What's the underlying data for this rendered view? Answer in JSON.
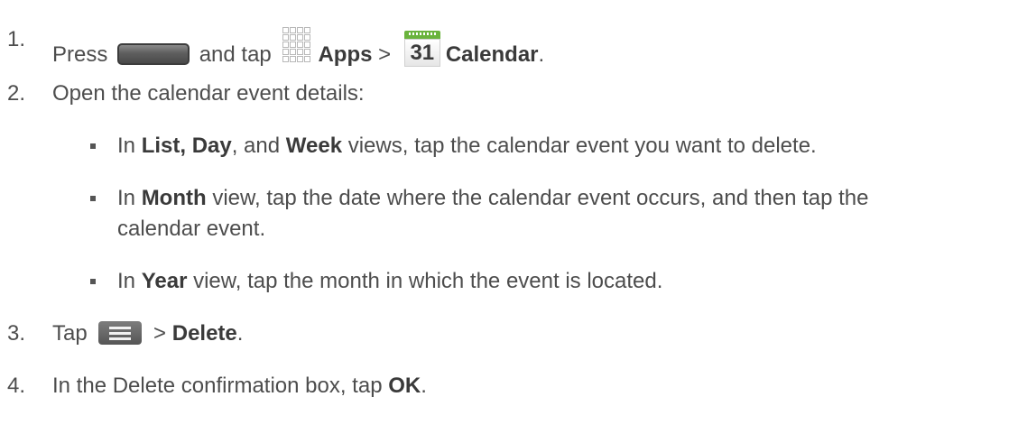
{
  "steps": [
    {
      "number": "1.",
      "press": "Press",
      "and_tap": "and tap",
      "apps": "Apps",
      "sep": ">",
      "cal_day": "31",
      "calendar": "Calendar",
      "end": "."
    },
    {
      "number": "2.",
      "text": "Open the calendar event details:"
    },
    {
      "number": "3.",
      "tap": "Tap",
      "sep": ">",
      "delete": "Delete",
      "end": "."
    },
    {
      "number": "4.",
      "pre": "In the Delete confirmation box, tap",
      "ok": "OK",
      "end": "."
    }
  ],
  "substeps": [
    {
      "in": "In",
      "bold1": "List, Day",
      "mid": ", and",
      "bold2": "Week",
      "rest": "views, tap the calendar event you want to delete."
    },
    {
      "in": "In",
      "bold": "Month",
      "rest": "view, tap the date where the calendar event occurs, and then tap the",
      "cont": "calendar event."
    },
    {
      "in": "In",
      "bold": "Year",
      "rest": "view, tap the month in which the event is located."
    }
  ],
  "icons": {
    "home_key": "home-key-icon",
    "apps": "apps-grid-icon",
    "calendar": "calendar-icon",
    "menu_key": "menu-key-icon"
  },
  "colors": {
    "text": "#4d4d4d",
    "calendar_green": "#6ab33d"
  }
}
